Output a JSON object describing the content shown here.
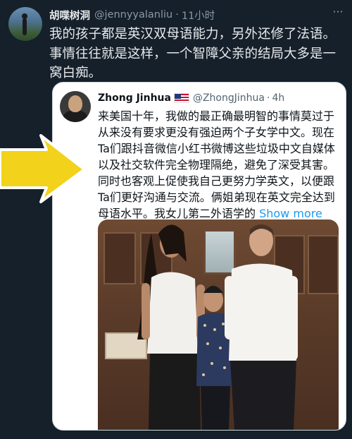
{
  "tweet": {
    "author_name": "胡喋树洞",
    "handle": "@jennyyalanliu",
    "separator": "·",
    "time": "11小时",
    "more_label": "···",
    "lines": [
      "我的孩子都是英汉双母语能力，另外还修了法语。",
      "事情往往就是这样，一个智障父亲的结局大多是一",
      "窝白痴。"
    ]
  },
  "quoted": {
    "author_name": "Zhong Jinhua",
    "flag_icon": "us-flag-icon",
    "handle": "@ZhongJinhua",
    "separator": "·",
    "time": "4h",
    "lines": [
      "来美国十年，我做的最正确最明智的事情莫过于",
      "从来没有要求更没有强迫两个子女学中文。现在",
      "Ta们跟抖音微信小红书微博这些垃圾中文自媒体",
      "以及社交软件完全物理隔绝，避免了深受其害。",
      "同时也客观上促使我自己更努力学英文，以便跟",
      "Ta们更好沟通与交流。俩姐弟现在英文完全达到"
    ],
    "last_line": "母语水平。我女儿第二外语学的 ",
    "show_more": "Show more"
  },
  "colors": {
    "background": "#15202b",
    "quote_bg": "#ffffff",
    "link": "#1d9bf0",
    "arrow": "#f2d21a"
  }
}
